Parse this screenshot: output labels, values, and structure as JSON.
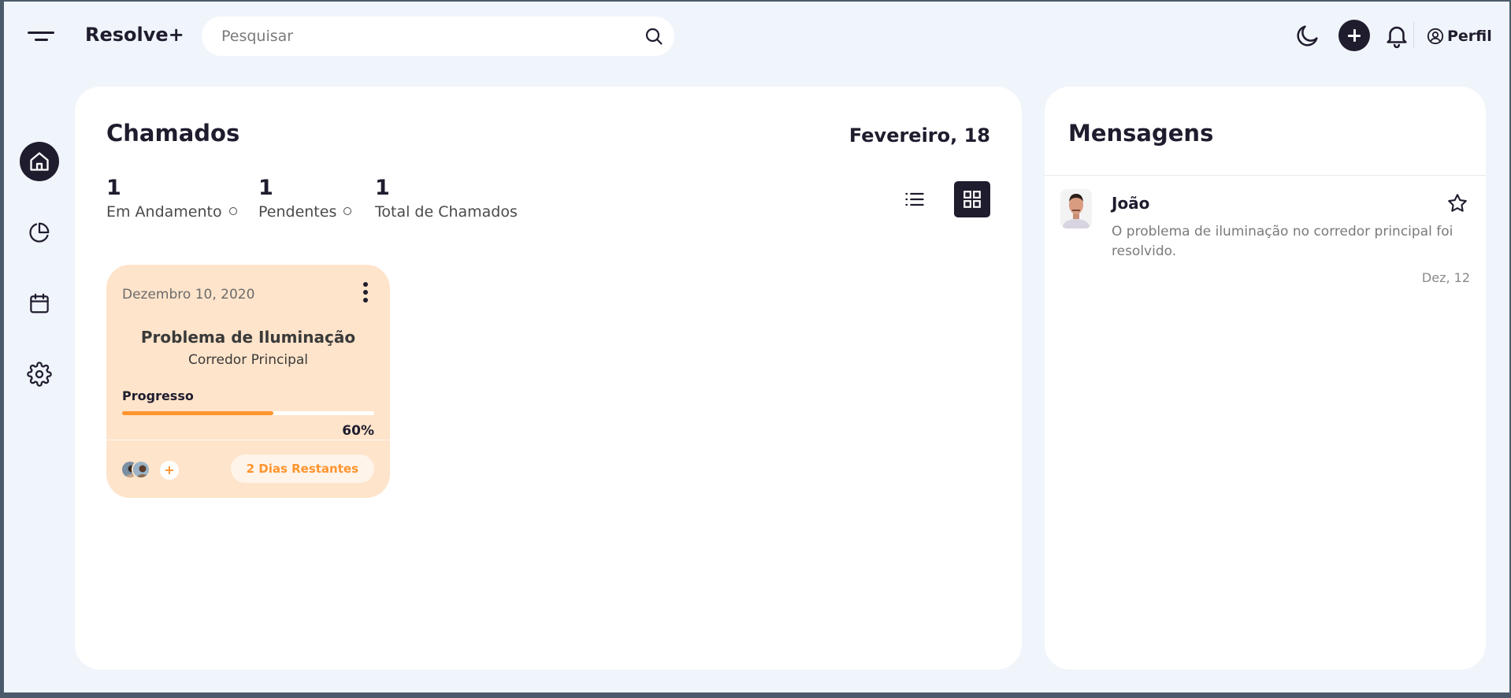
{
  "header": {
    "app_name": "Resolve+",
    "search_placeholder": "Pesquisar",
    "profile_label": "Perfil"
  },
  "sidebar": {
    "items": [
      {
        "icon": "home-icon",
        "active": true
      },
      {
        "icon": "pie-chart-icon",
        "active": false
      },
      {
        "icon": "calendar-icon",
        "active": false
      },
      {
        "icon": "gear-icon",
        "active": false
      }
    ]
  },
  "projects": {
    "title": "Chamados",
    "date": "Fevereiro, 18",
    "stats": [
      {
        "value": "1",
        "label": "Em Andamento"
      },
      {
        "value": "1",
        "label": "Pendentes"
      },
      {
        "value": "1",
        "label": "Total de Chamados"
      }
    ],
    "view_mode": "grid",
    "cards": [
      {
        "date": "Dezembro 10, 2020",
        "title": "Problema de Iluminação",
        "subtitle": "Corredor Principal",
        "progress_label": "Progresso",
        "progress_value": 60,
        "progress_text": "60%",
        "add_participant": "+",
        "days_left": "2 Dias Restantes",
        "colors": {
          "background": "#fee4cb",
          "accent": "#ff942e"
        }
      }
    ]
  },
  "messages": {
    "title": "Mensagens",
    "items": [
      {
        "name": "João",
        "text": "O problema de iluminação no corredor principal foi resolvido.",
        "date": "Dez, 12"
      }
    ]
  },
  "colors": {
    "dark": "#1f1c2e",
    "background": "#f0f4fb",
    "accent": "#ff942e"
  }
}
